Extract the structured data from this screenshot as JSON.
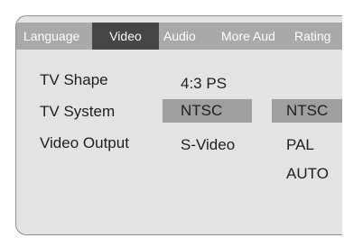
{
  "tabs": [
    {
      "label": "Language",
      "active": false
    },
    {
      "label": "Video",
      "active": true
    },
    {
      "label": "Audio",
      "active": false
    },
    {
      "label": "More Aud",
      "active": false
    },
    {
      "label": "Rating",
      "active": false
    }
  ],
  "settings": {
    "rows": [
      {
        "label": "TV Shape",
        "value": "4:3 PS"
      },
      {
        "label": "TV System",
        "value": "NTSC"
      },
      {
        "label": "Video Output",
        "value": "S-Video"
      }
    ]
  },
  "submenu": {
    "options": [
      "NTSC",
      "PAL",
      "AUTO"
    ],
    "highlighted": "NTSC"
  },
  "colors": {
    "panel": "#e3e3e3",
    "tabbar": "#a9a9a9",
    "active_tab": "#464646",
    "highlight": "#9f9f9f",
    "text": "#1f1f1f"
  }
}
